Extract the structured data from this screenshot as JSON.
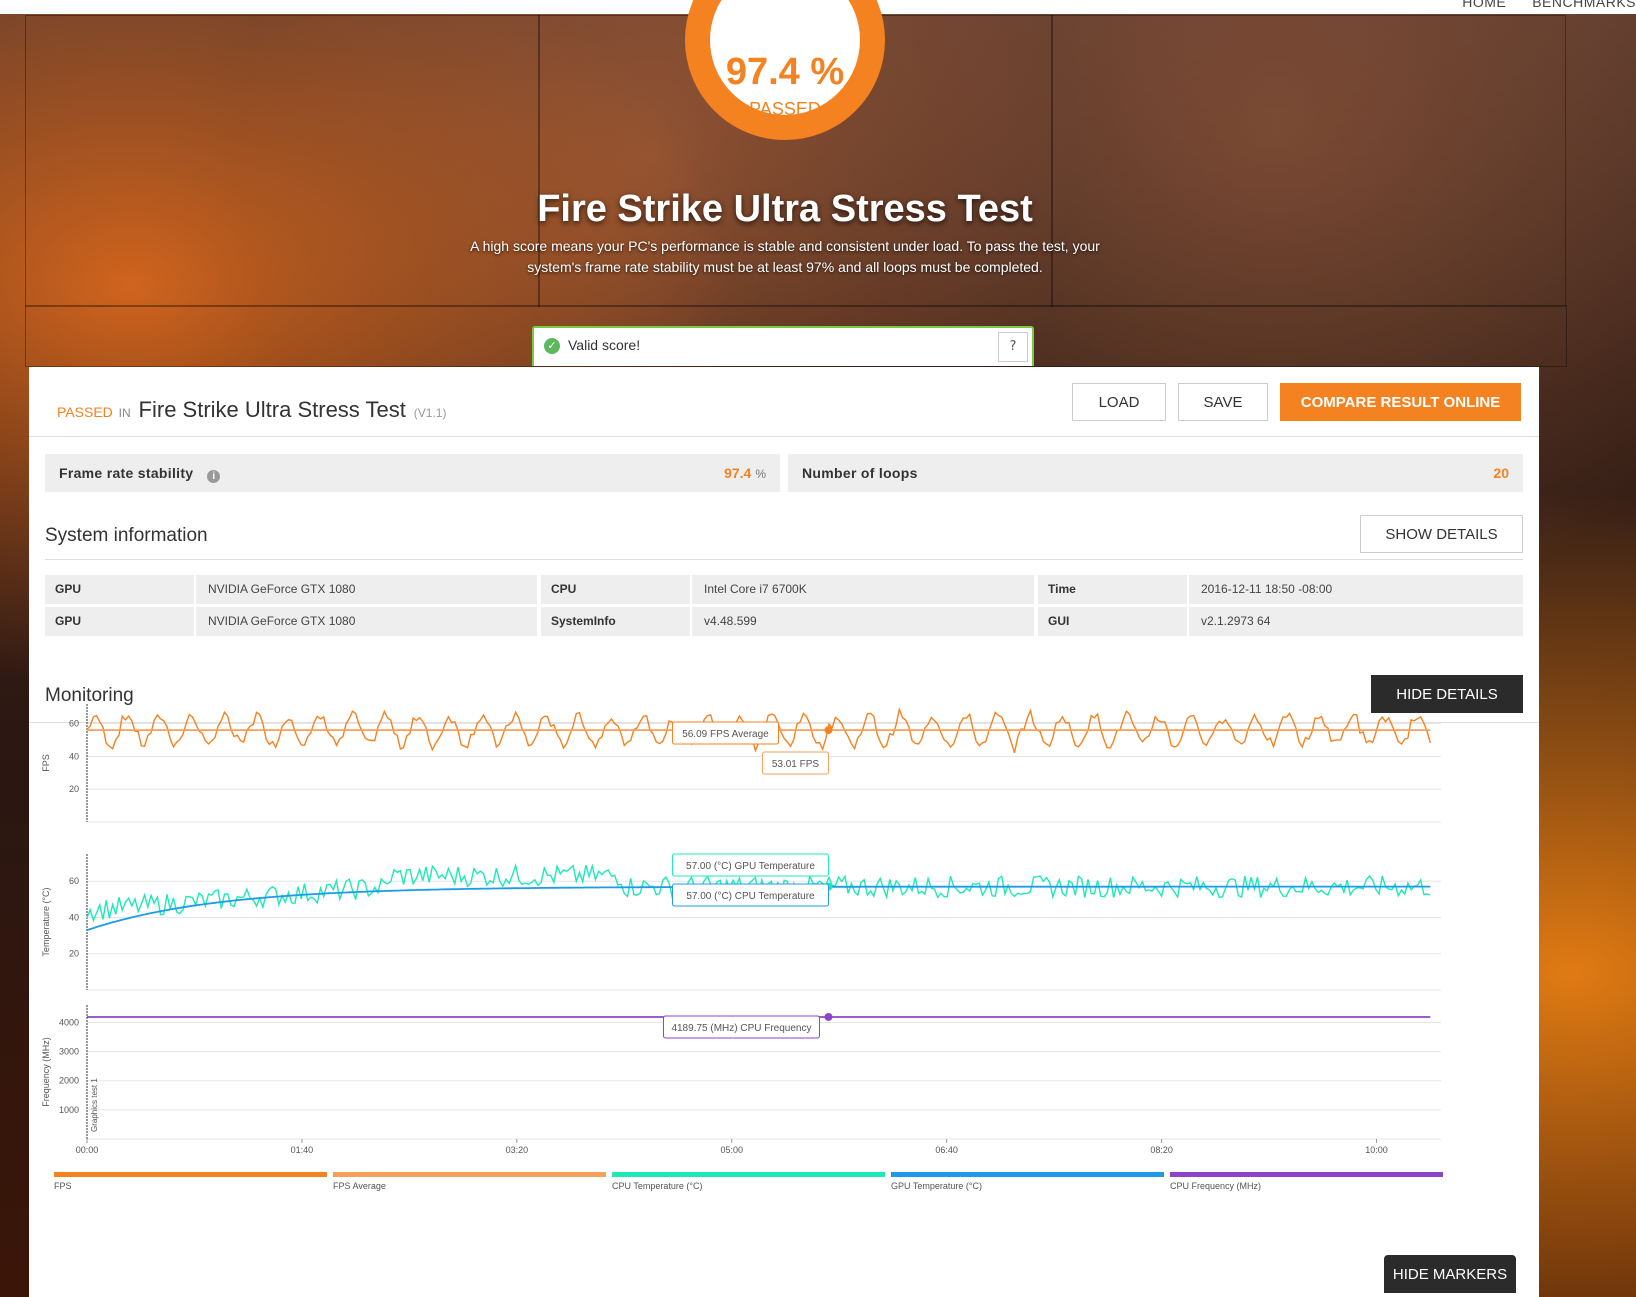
{
  "nav": {
    "items": [
      "HOME",
      "BENCHMARKS"
    ]
  },
  "score": {
    "value": "97.4 %",
    "label": "PASSED"
  },
  "hero": {
    "title": "Fire Strike Ultra Stress Test",
    "description": "A high score means your PC's performance is stable and consistent under load. To pass the test, your system's frame rate stability must be at least 97% and all loops must be completed."
  },
  "valid": {
    "text": "Valid score!",
    "help": "?"
  },
  "result": {
    "status": "PASSED",
    "in": "IN",
    "test_name": "Fire Strike Ultra Stress Test",
    "version": "(V1.1)"
  },
  "actions": {
    "load": "LOAD",
    "save": "SAVE",
    "compare": "COMPARE RESULT ONLINE"
  },
  "stats": {
    "stability_label": "Frame rate stability",
    "stability_value": "97.4",
    "stability_unit": "%",
    "loops_label": "Number of loops",
    "loops_value": "20"
  },
  "system": {
    "title": "System information",
    "show_details": "SHOW DETAILS",
    "rows": [
      [
        "GPU",
        "NVIDIA GeForce GTX 1080",
        "CPU",
        "Intel Core i7 6700K",
        "Time",
        "2016-12-11 18:50 -08:00"
      ],
      [
        "GPU",
        "NVIDIA GeForce GTX 1080",
        "SystemInfo",
        "v4.48.599",
        "GUI",
        "v2.1.2973 64"
      ]
    ]
  },
  "monitoring": {
    "title": "Monitoring",
    "hide_details": "HIDE DETAILS",
    "hide_markers": "HIDE MARKERS"
  },
  "chart_data": {
    "type": "line",
    "x_ticks": [
      "00:00",
      "01:40",
      "03:20",
      "05:00",
      "06:40",
      "08:20",
      "10:00"
    ],
    "x_range_seconds": [
      0,
      630
    ],
    "marker_label": "Graphics test 1",
    "panels": [
      {
        "ylabel": "FPS",
        "yticks": [
          20,
          40,
          60
        ],
        "ylim": [
          0,
          72
        ],
        "series": [
          {
            "name": "FPS",
            "color": "#f58220",
            "mean": 56,
            "amplitude": 11,
            "period_s": 15
          },
          {
            "name": "FPS Average",
            "color": "#f5a05a",
            "constant": 56.09
          }
        ],
        "tooltips": [
          "56.09 FPS Average",
          "53.01 FPS"
        ]
      },
      {
        "ylabel": "Temperature (°C)",
        "yticks": [
          20,
          40,
          60
        ],
        "ylim": [
          0,
          75
        ],
        "series": [
          {
            "name": "CPU Temperature (°C)",
            "color": "#1de9b6",
            "start": 44,
            "plateau": 57,
            "noise": 6
          },
          {
            "name": "GPU Temperature (°C)",
            "color": "#1e9be8",
            "start": 33,
            "plateau": 57
          }
        ],
        "tooltips": [
          "57.00 (°C) GPU Temperature",
          "57.00 (°C) CPU Temperature"
        ]
      },
      {
        "ylabel": "Frequency (MHz)",
        "yticks": [
          1000,
          2000,
          3000,
          4000
        ],
        "ylim": [
          0,
          4600
        ],
        "series": [
          {
            "name": "CPU Frequency (MHz)",
            "color": "#8e44c9",
            "constant": 4189.75
          }
        ],
        "tooltips": [
          "4189.75 (MHz) CPU Frequency"
        ]
      }
    ],
    "legend": [
      {
        "name": "FPS",
        "color": "#f58220"
      },
      {
        "name": "FPS Average",
        "color": "#f5a05a"
      },
      {
        "name": "CPU Temperature (°C)",
        "color": "#1de9b6"
      },
      {
        "name": "GPU Temperature (°C)",
        "color": "#1e9be8"
      },
      {
        "name": "CPU Frequency (MHz)",
        "color": "#8e44c9"
      }
    ],
    "cursor_time_s": 345
  }
}
